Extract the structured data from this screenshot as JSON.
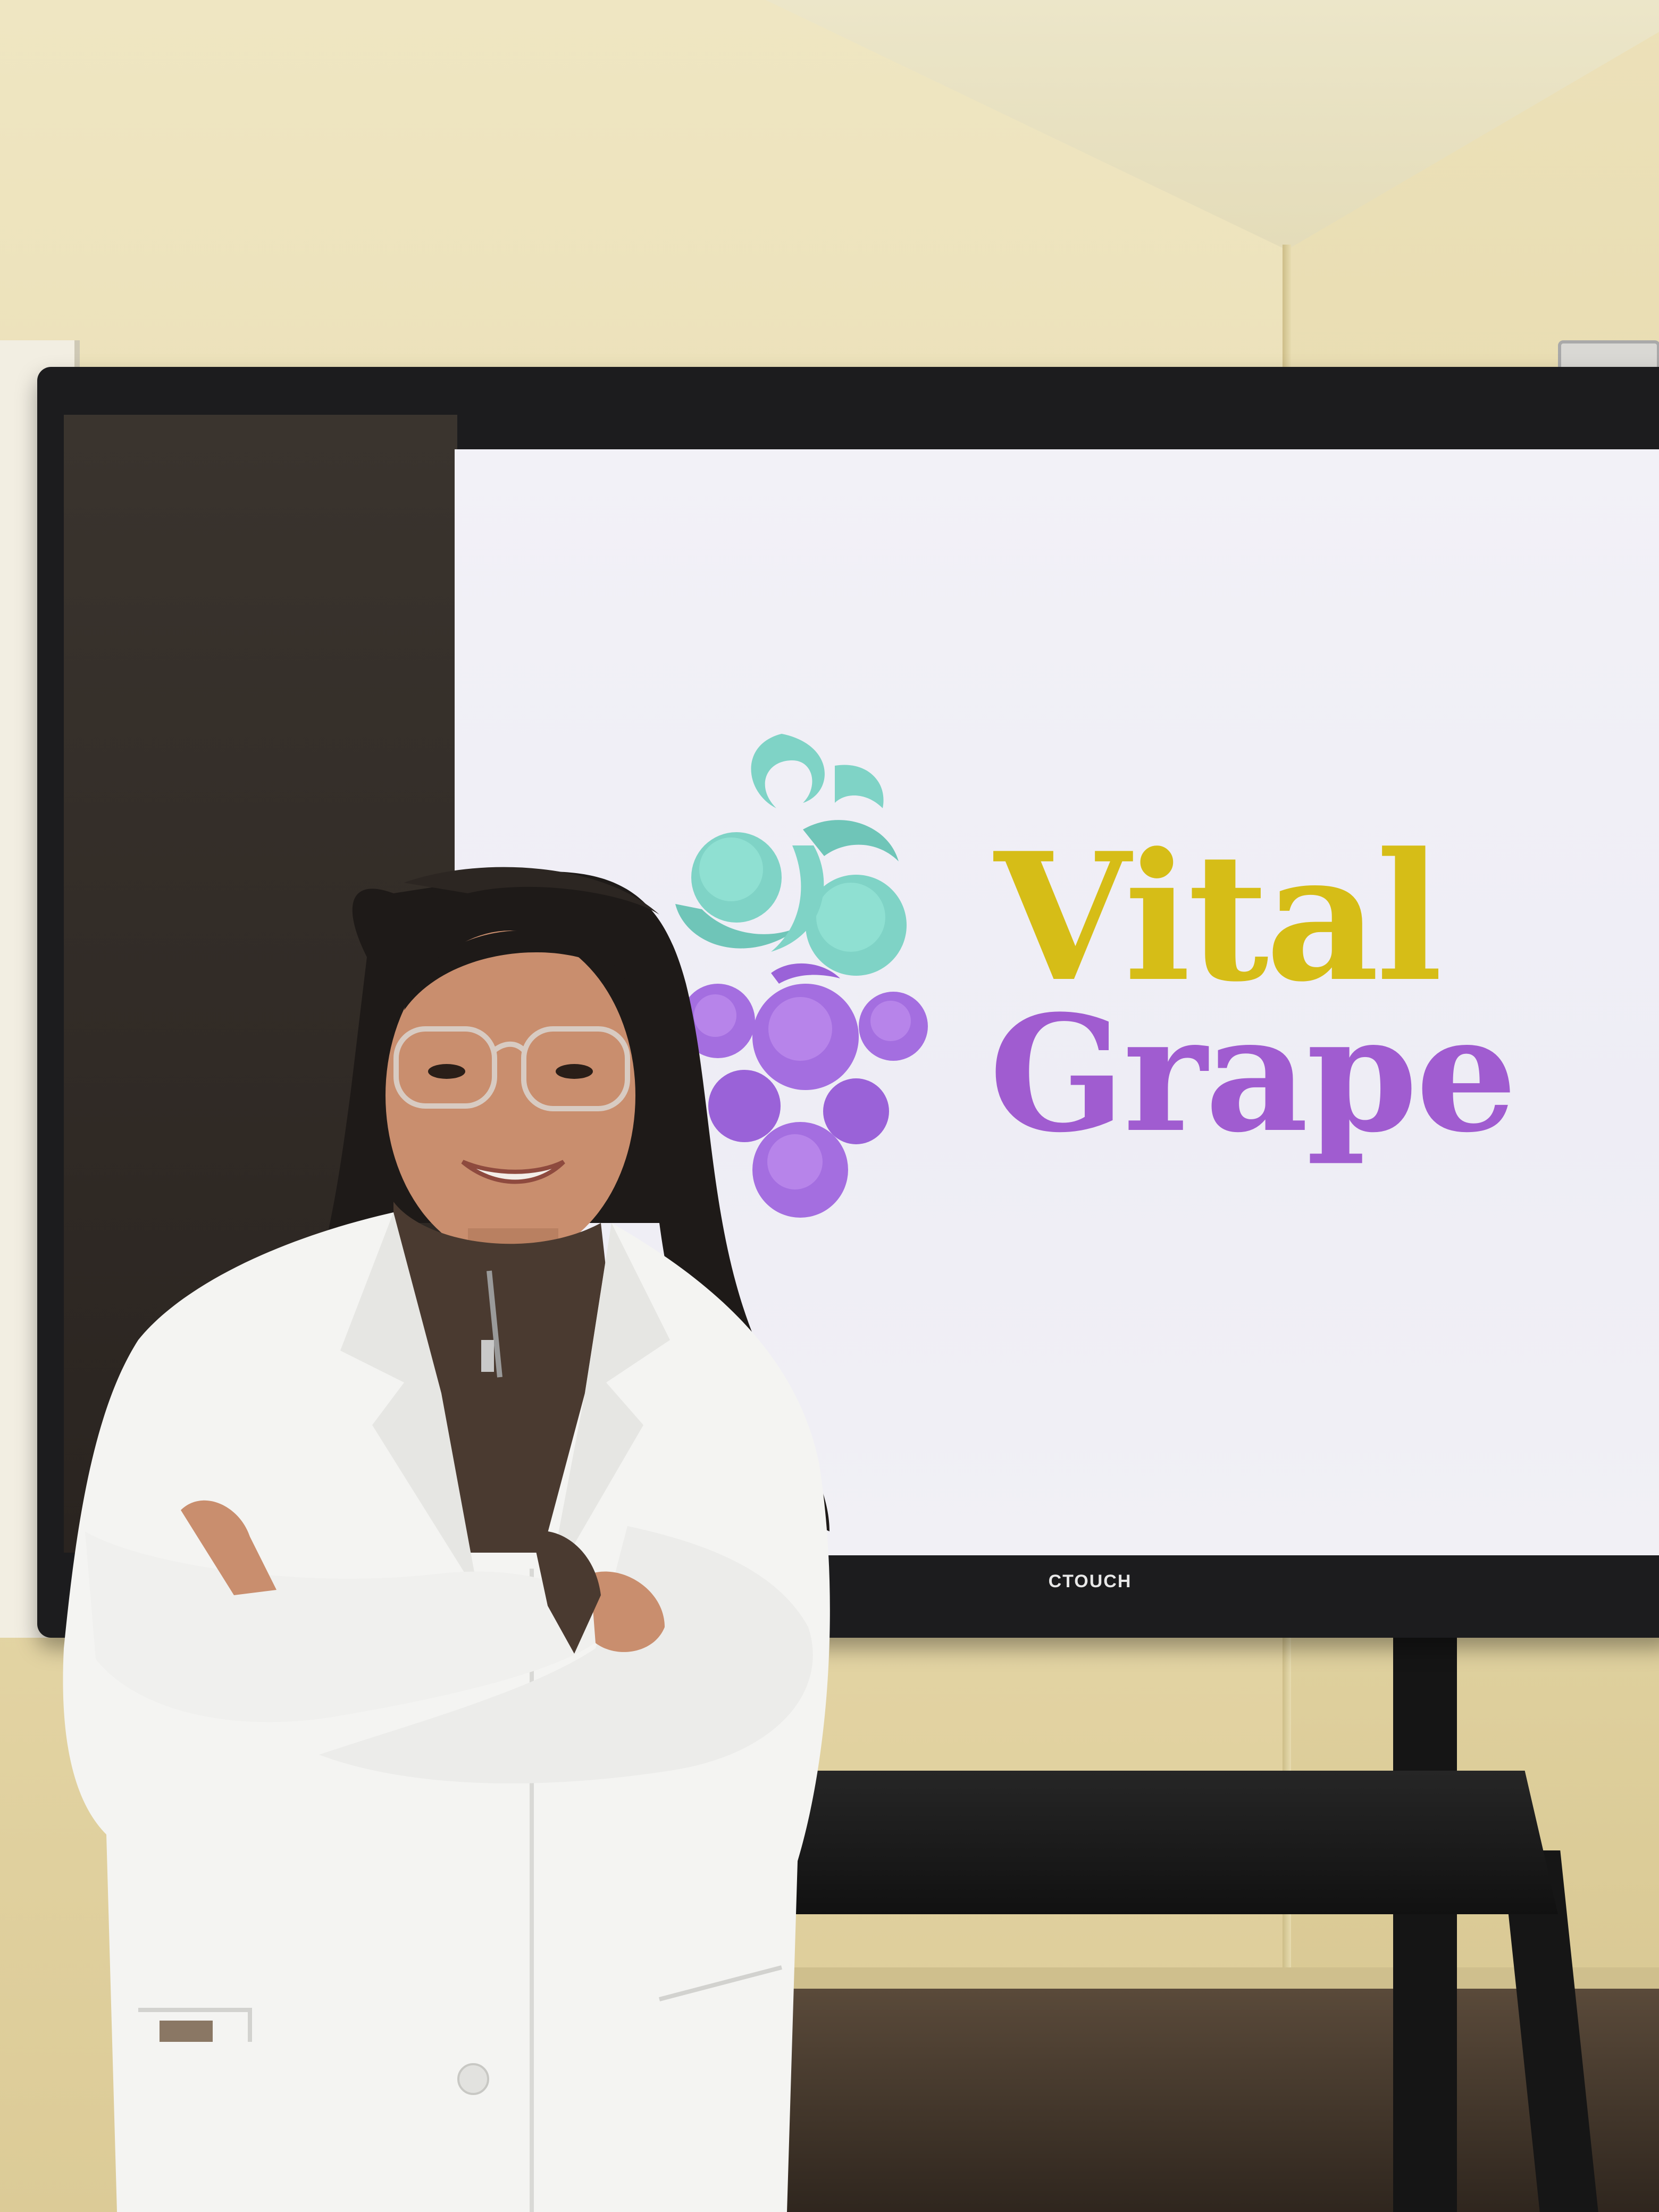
{
  "scene": {
    "description_colors": {
      "wall": "#e9ddb4",
      "screen_bezel": "#1c1c1e",
      "display_background": "#f2f1f7",
      "lab_coat": "#f4f4f2",
      "sweater": "#4a3a30",
      "hair": "#1e1a18"
    }
  },
  "display": {
    "brand": "CTOUCH",
    "logo": {
      "line1": "Vital",
      "line2": "Grape",
      "color_line1": "#d6bd17",
      "color_line2": "#a05cd0",
      "leaf_color": "#7fd3c6",
      "grape_color": "#a46ee0"
    }
  }
}
